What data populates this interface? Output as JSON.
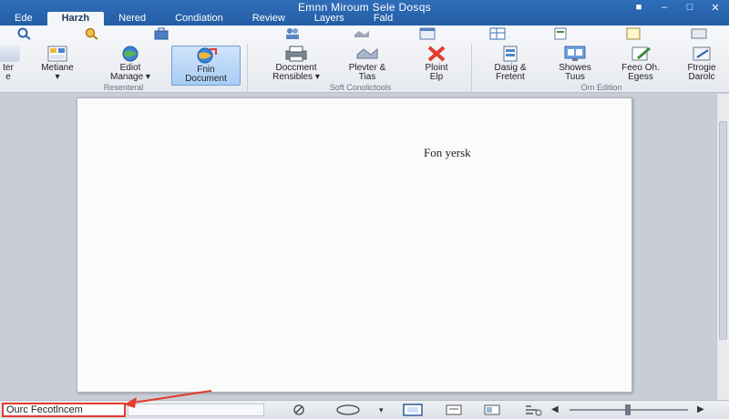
{
  "window": {
    "title": "Emnn Miroum Sele Dosqs"
  },
  "tabs": [
    {
      "label": "Ede"
    },
    {
      "label": "Harzh",
      "active": true
    },
    {
      "label": "Nered"
    },
    {
      "label": "Condiation"
    },
    {
      "label": "Review"
    },
    {
      "label": "Layers"
    },
    {
      "label": "Fald"
    }
  ],
  "ribbon": {
    "groups": [
      {
        "label": "Resenteral",
        "buttons": [
          {
            "label1": "ter",
            "label2": "e",
            "icon": "partial-icon"
          },
          {
            "label1": "Metiane",
            "label2": "",
            "icon": "grid-icon"
          },
          {
            "label1": "Ediot",
            "label2": "Manage",
            "icon": "globe-icon"
          },
          {
            "label1": "Fnin",
            "label2": "Document",
            "icon": "globe-arrow-icon",
            "selected": true
          }
        ]
      },
      {
        "label": "Soft Conolictools",
        "buttons": [
          {
            "label1": "Doccment",
            "label2": "Rensibles",
            "icon": "printer-icon"
          },
          {
            "label1": "Plevter &",
            "label2": "Tias",
            "icon": "handshake-icon"
          },
          {
            "label1": "Ploint",
            "label2": "Elp",
            "icon": "red-x-icon"
          }
        ]
      },
      {
        "label": "Orn Edition",
        "buttons": [
          {
            "label1": "Dasig &",
            "label2": "Fretent",
            "icon": "document-table-icon"
          },
          {
            "label1": "Showes",
            "label2": "Tuus",
            "icon": "monitor-icon"
          },
          {
            "label1": "Feeo Oh.",
            "label2": "Egess",
            "icon": "pencil-doc-icon"
          },
          {
            "label1": "Ftrogie",
            "label2": "Darolc",
            "icon": "pen-icon"
          }
        ]
      }
    ]
  },
  "document": {
    "text": "Fon yersk"
  },
  "statusbar": {
    "field_text": "Ourc Fecotlncem"
  },
  "colors": {
    "title_blue": "#2a66b0",
    "highlight_red": "#e33b2e"
  }
}
